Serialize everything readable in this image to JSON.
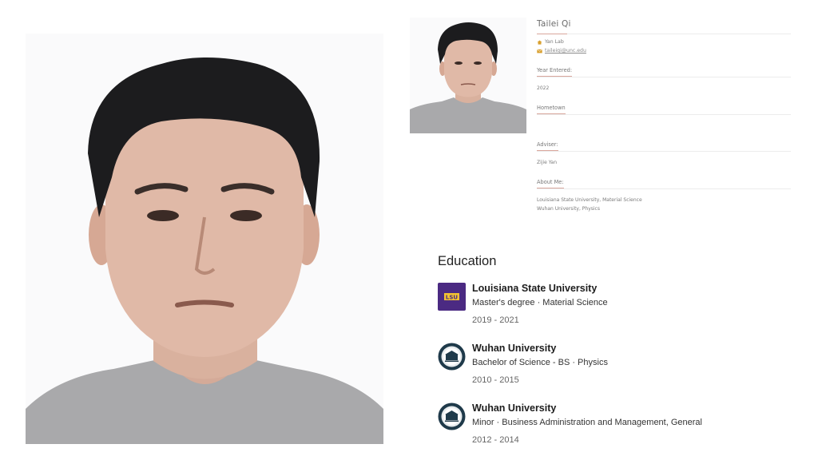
{
  "profile": {
    "name": "Tailei Qi",
    "lab": "Yan Lab",
    "email": "taileiqi@unc.edu",
    "sections": [
      {
        "label": "Year Entered:",
        "value": "2022"
      },
      {
        "label": "Hometown",
        "value": ""
      },
      {
        "label": "Adviser:",
        "value": "Zijie Yan"
      },
      {
        "label": "About Me:",
        "value": "Louisiana State University, Material Science",
        "value2": "Wuhan University, Physics"
      }
    ]
  },
  "education": {
    "title": "Education",
    "items": [
      {
        "school": "Louisiana State University",
        "degree": "Master's degree · Material Science",
        "years": "2019 - 2021",
        "logo": "lsu-logo",
        "logo_text": "LSU"
      },
      {
        "school": "Wuhan University",
        "degree": "Bachelor of Science - BS · Physics",
        "years": "2010 - 2015",
        "logo": "wuhan-university-logo"
      },
      {
        "school": "Wuhan University",
        "degree": "Minor · Business Administration and Management, General",
        "years": "2012 - 2014",
        "logo": "wuhan-university-logo"
      }
    ]
  },
  "colors": {
    "accent_underline": "#d9a79d",
    "lsu_purple": "#4b2a82",
    "lsu_gold": "#f2c230",
    "whu_navy": "#1f3a4a"
  }
}
